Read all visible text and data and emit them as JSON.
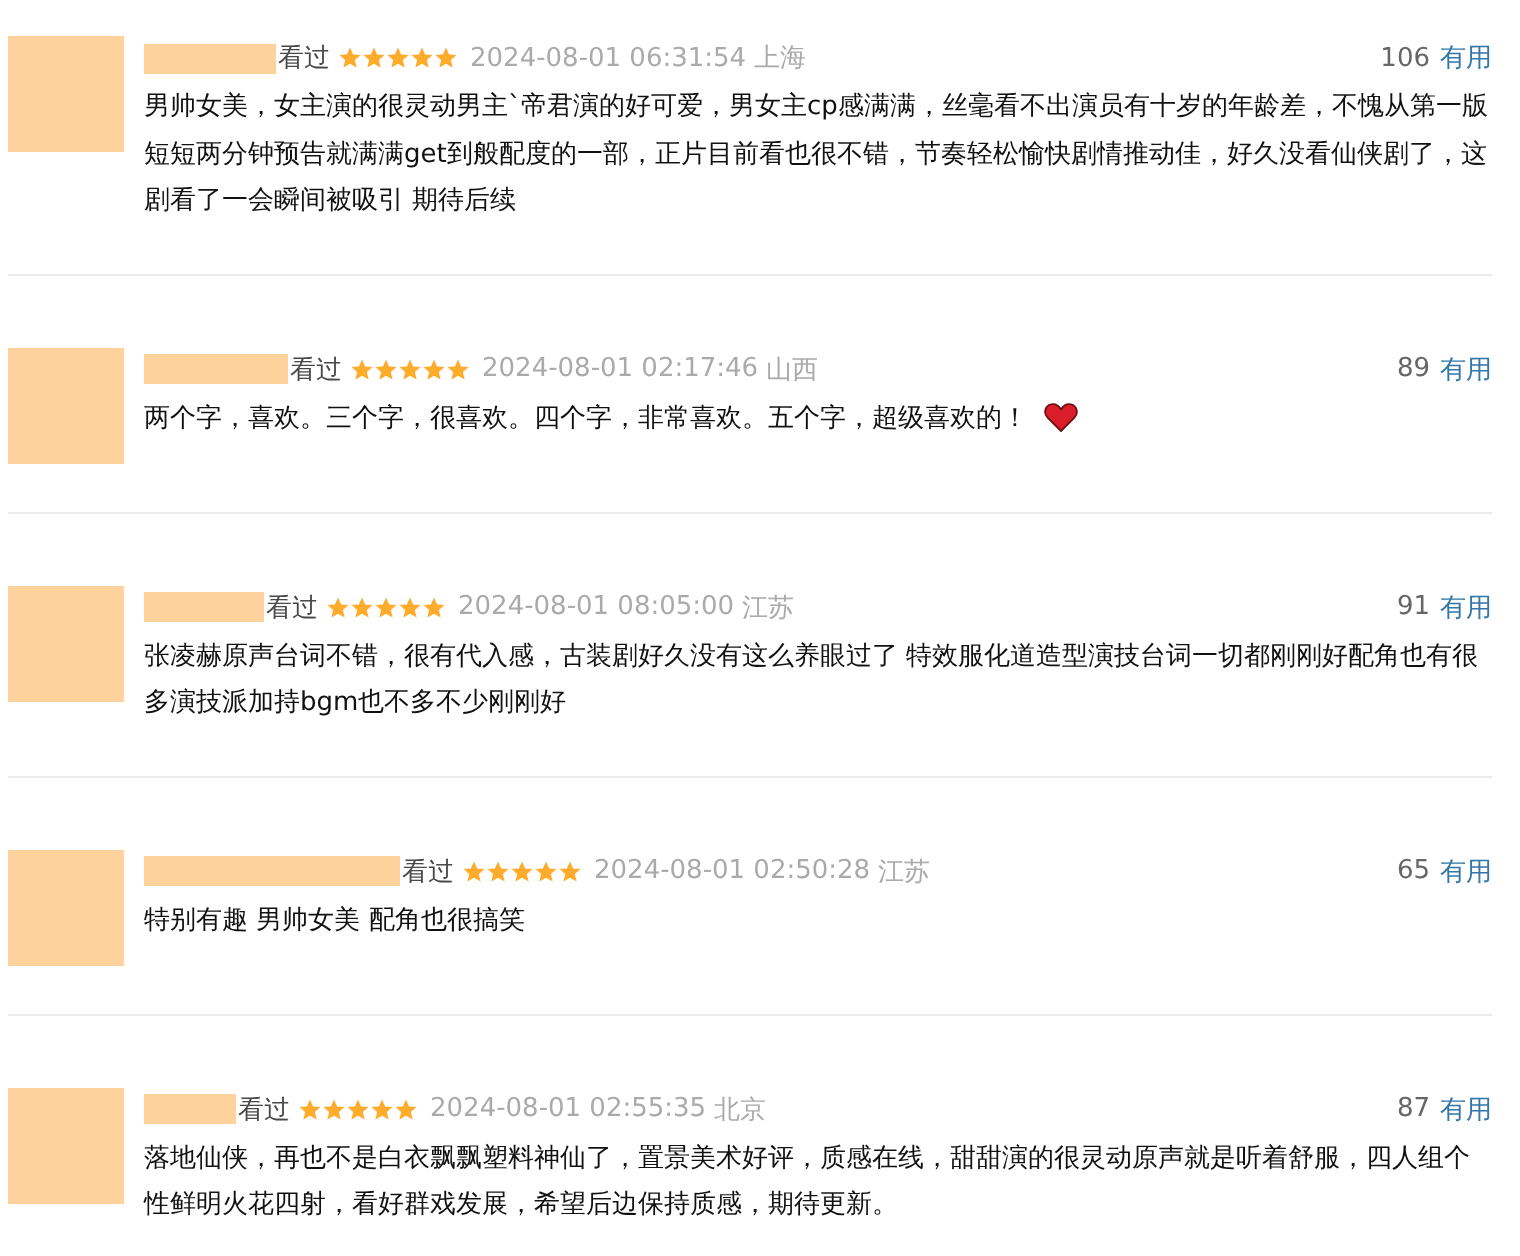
{
  "reviews": [
    {
      "status": "看过",
      "stars": 5,
      "time": "2024-08-01 06:31:54",
      "location": "上海",
      "votes": "106",
      "useful": "有用",
      "text": "男帅女美，女主演的很灵动男主`帝君演的好可爱，男女主cp感满满，丝毫看不出演员有十岁的年龄差，不愧从第一版短短两分钟预告就满满get到般配度的一部，正片目前看也很不错，节奏轻松愉快剧情推动佳，好久没看仙侠剧了，这剧看了一会瞬间被吸引 期待后续",
      "heart": false
    },
    {
      "status": "看过",
      "stars": 5,
      "time": "2024-08-01 02:17:46",
      "location": "山西",
      "votes": "89",
      "useful": "有用",
      "text": "两个字，喜欢。三个字，很喜欢。四个字，非常喜欢。五个字，超级喜欢的！",
      "heart": true
    },
    {
      "status": "看过",
      "stars": 5,
      "time": "2024-08-01 08:05:00",
      "location": "江苏",
      "votes": "91",
      "useful": "有用",
      "text": "张凌赫原声台词不错，很有代入感，古装剧好久没有这么养眼过了 特效服化道造型演技台词一切都刚刚好配角也有很多演技派加持bgm也不多不少刚刚好",
      "heart": false
    },
    {
      "status": "看过",
      "stars": 5,
      "time": "2024-08-01 02:50:28",
      "location": "江苏",
      "votes": "65",
      "useful": "有用",
      "text": "特别有趣 男帅女美 配角也很搞笑",
      "heart": false
    },
    {
      "status": "看过",
      "stars": 5,
      "time": "2024-08-01 02:55:35",
      "location": "北京",
      "votes": "87",
      "useful": "有用",
      "text": "落地仙侠，再也不是白衣飘飘塑料神仙了，置景美术好评，质感在线，甜甜演的很灵动原声就是听着舒服，四人组个性鲜明火花四射，看好群戏发展，希望后边保持质感，期待更新。",
      "heart": false
    }
  ]
}
